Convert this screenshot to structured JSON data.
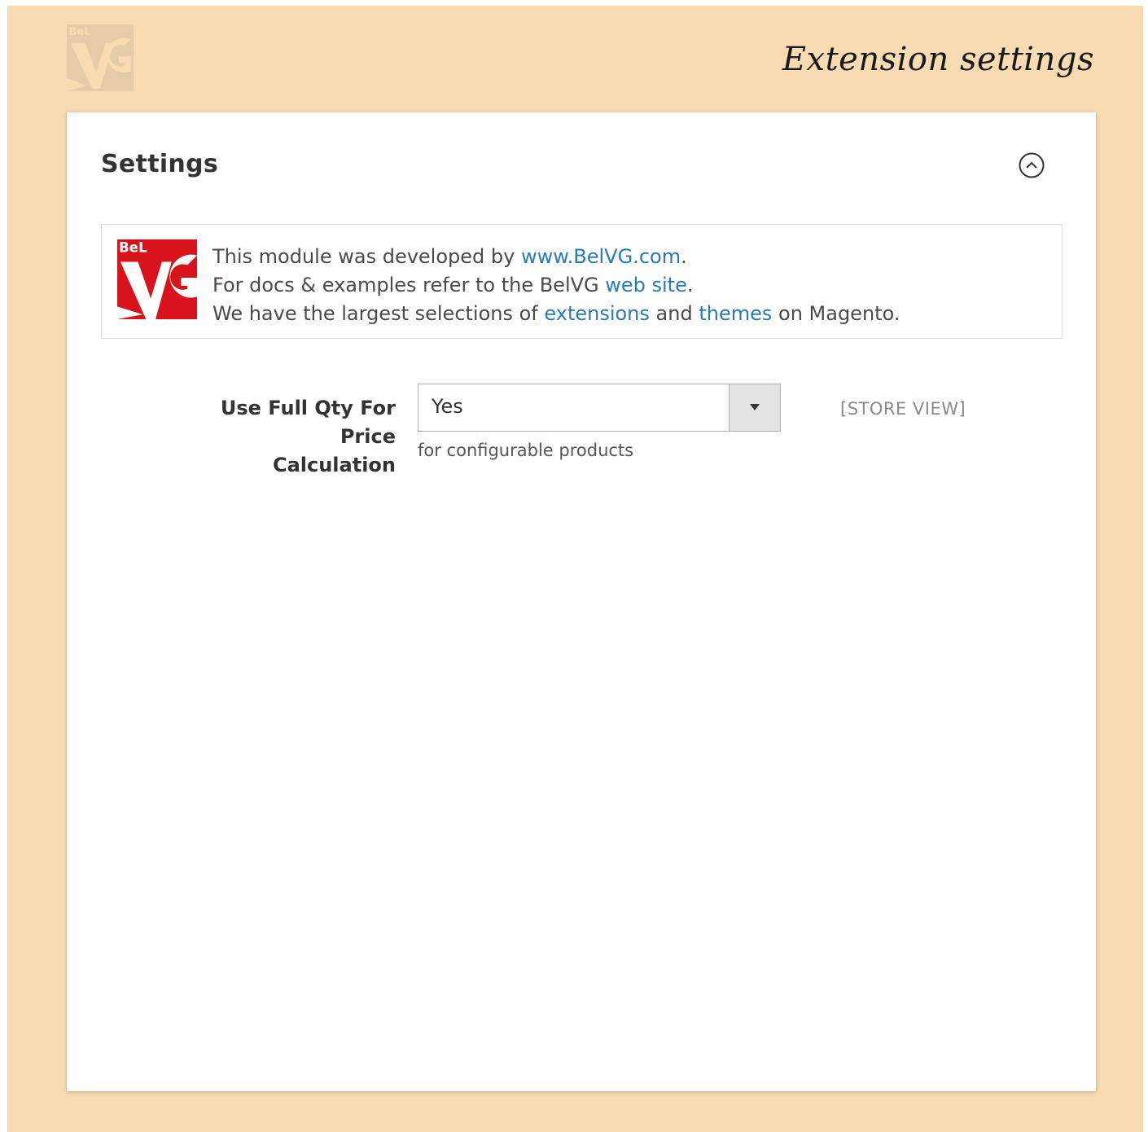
{
  "page": {
    "heading": "Extension settings",
    "background_color": "#f8dbb3"
  },
  "section": {
    "title": "Settings",
    "collapse_icon": "chevron-up-circle-icon"
  },
  "info_box": {
    "logo_alt": "BelVG",
    "line1_prefix": "This module was developed by ",
    "line1_link": "www.BelVG.com",
    "line1_suffix": ".",
    "line2_prefix": "For docs & examples refer to the BelVG ",
    "line2_link": "web site",
    "line2_suffix": ".",
    "line3_prefix": "We have the largest selections of ",
    "line3_link1": "extensions",
    "line3_middle": " and ",
    "line3_link2": "themes",
    "line3_suffix": " on Magento.",
    "link_color": "#2a7ab8",
    "logo_color": "#d8131b"
  },
  "field": {
    "label_line1": "Use Full Qty For Price",
    "label_line2": "Calculation",
    "value": "Yes",
    "note": "for configurable products",
    "scope": "[STORE VIEW]"
  }
}
